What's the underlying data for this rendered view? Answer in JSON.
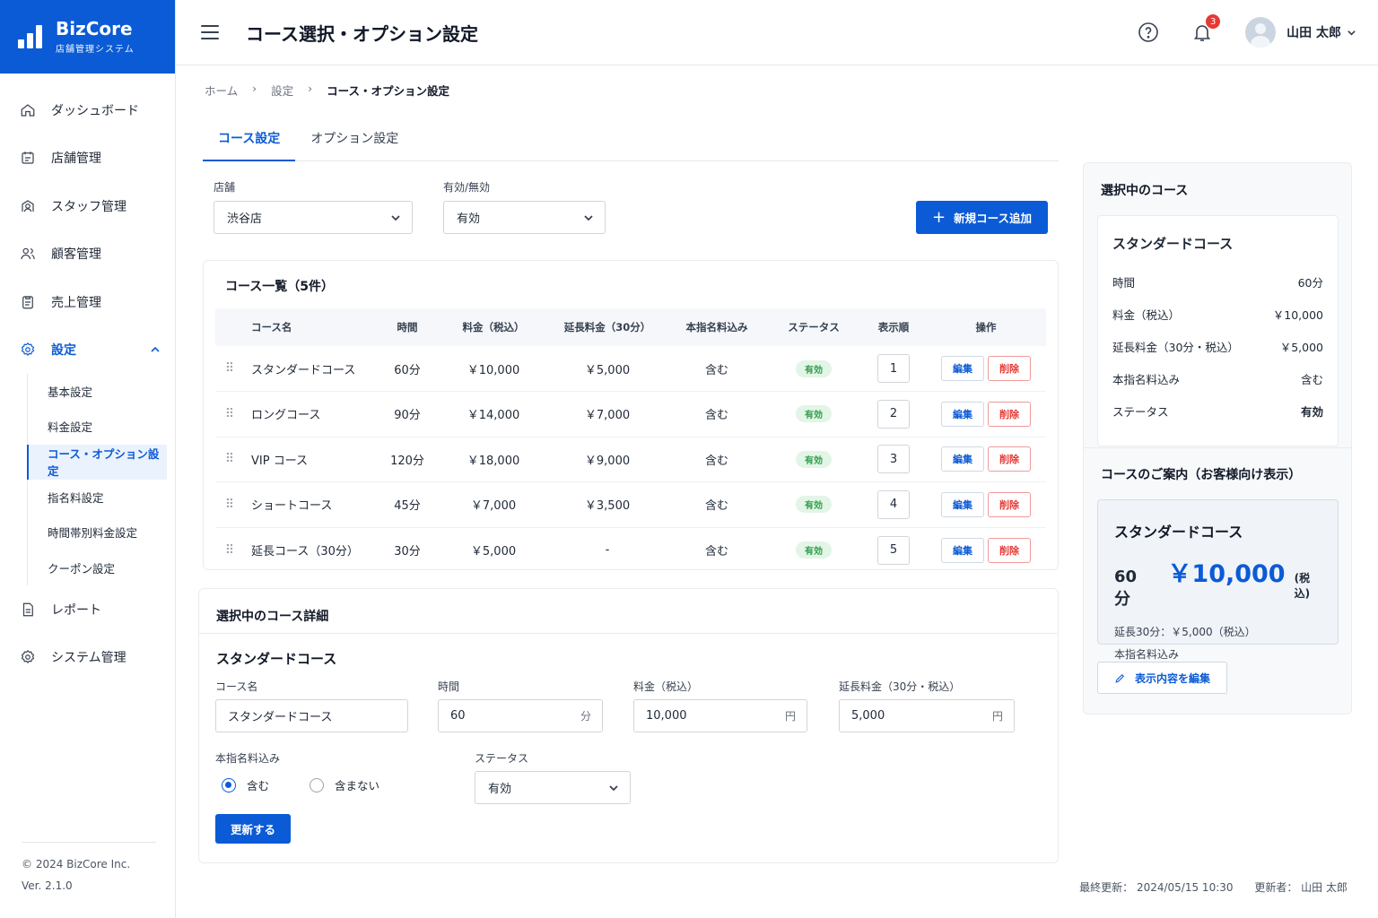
{
  "brand": {
    "name": "BizCore",
    "subtitle": "店舗管理システム"
  },
  "sidebar": {
    "items": [
      {
        "label": "ダッシュボード",
        "icon": "home-icon"
      },
      {
        "label": "店舗管理",
        "icon": "store-icon"
      },
      {
        "label": "スタッフ管理",
        "icon": "staff-icon"
      },
      {
        "label": "顧客管理",
        "icon": "users-icon"
      },
      {
        "label": "売上管理",
        "icon": "clipboard-icon"
      },
      {
        "label": "設定",
        "icon": "gear-icon"
      },
      {
        "label": "レポート",
        "icon": "document-icon"
      },
      {
        "label": "システム管理",
        "icon": "gear-icon"
      }
    ],
    "sub_items": [
      "基本設定",
      "料金設定",
      "コース・オプション設定",
      "指名料設定",
      "時間帯別料金設定",
      "クーポン設定"
    ],
    "footer_copyright": "© 2024 BizCore Inc.",
    "footer_version": "Ver. 2.1.0"
  },
  "header": {
    "title": "コース選択・オプション設定",
    "notification_count": "3",
    "user_name": "山田 太郎"
  },
  "breadcrumb": {
    "home": "ホーム",
    "settings": "設定",
    "current": "コース・オプション設定"
  },
  "tabs": {
    "course": "コース設定",
    "option": "オプション設定"
  },
  "filters": {
    "store_label": "店舗",
    "store_value": "渋谷店",
    "status_label": "有効/無効",
    "status_value": "有効",
    "add_button": "新規コース追加"
  },
  "course_list": {
    "title": "コース一覧（5件）",
    "columns": [
      "コース名",
      "時間",
      "料金（税込）",
      "延長料金（30分）",
      "本指名料込み",
      "ステータス",
      "表示順",
      "操作"
    ],
    "rows": [
      {
        "name": "スタンダードコース",
        "time": "60分",
        "price": "￥10,000",
        "ext": "￥5,000",
        "nomination": "含む",
        "status": "有効",
        "order": "1"
      },
      {
        "name": "ロングコース",
        "time": "90分",
        "price": "￥14,000",
        "ext": "￥7,000",
        "nomination": "含む",
        "status": "有効",
        "order": "2"
      },
      {
        "name": "VIP コース",
        "time": "120分",
        "price": "￥18,000",
        "ext": "￥9,000",
        "nomination": "含む",
        "status": "有効",
        "order": "3"
      },
      {
        "name": "ショートコース",
        "time": "45分",
        "price": "￥7,000",
        "ext": "￥3,500",
        "nomination": "含む",
        "status": "有効",
        "order": "4"
      },
      {
        "name": "延長コース（30分）",
        "time": "30分",
        "price": "￥5,000",
        "ext": "-",
        "nomination": "含む",
        "status": "有効",
        "order": "5"
      }
    ],
    "edit_label": "編集",
    "delete_label": "削除"
  },
  "detail": {
    "section_title": "選択中のコース詳細",
    "course_title": "スタンダードコース",
    "name_label": "コース名",
    "name_value": "スタンダードコース",
    "time_label": "時間",
    "time_value": "60",
    "time_unit": "分",
    "price_label": "料金（税込）",
    "price_value": "10,000",
    "price_unit": "円",
    "ext_label": "延長料金（30分・税込）",
    "ext_value": "5,000",
    "ext_unit": "円",
    "nomination_label": "本指名料込み",
    "radio_include": "含む",
    "radio_exclude": "含まない",
    "status_label": "ステータス",
    "status_value": "有効",
    "update_button": "更新する"
  },
  "selected_panel": {
    "title": "選択中のコース",
    "course_name": "スタンダードコース",
    "rows": [
      {
        "k": "時間",
        "v": "60分"
      },
      {
        "k": "料金（税込）",
        "v": "￥10,000"
      },
      {
        "k": "延長料金（30分・税込）",
        "v": "￥5,000"
      },
      {
        "k": "本指名料込み",
        "v": "含む"
      },
      {
        "k": "ステータス",
        "v": "有効"
      }
    ]
  },
  "guide": {
    "title": "コースのご案内（お客様向け表示）",
    "course_name": "スタンダードコース",
    "time": "60分",
    "price": "￥10,000",
    "tax": "(税込)",
    "ext": "延長30分：￥5,000（税込）",
    "nomination": "本指名料込み",
    "edit_button": "表示内容を編集"
  },
  "meta": {
    "last_updated": "最終更新： 2024/05/15 10:30",
    "updated_by": "更新者： 山田 太郎"
  },
  "colors": {
    "primary": "#0b5bd6",
    "danger": "#e53935",
    "success": "#2e9e4b"
  }
}
